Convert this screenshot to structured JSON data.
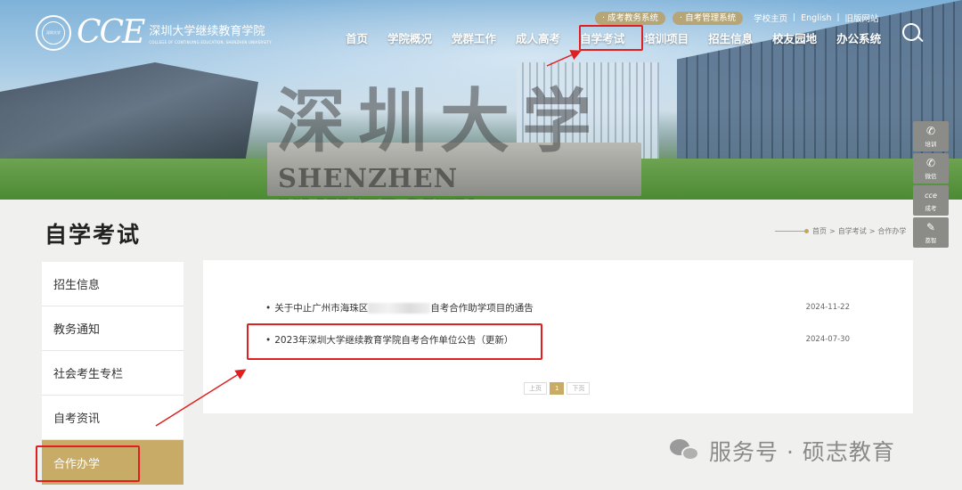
{
  "header": {
    "logo": {
      "seal_text": "深圳大学",
      "cce": "CCE",
      "name_cn": "深圳大学继续教育学院",
      "name_en": "COLLEGE OF CONTINUING EDUCATION, SHENZHEN UNIVERSITY"
    },
    "top_links": {
      "pill_1": "· 成考教务系统",
      "pill_2": "· 自考管理系统",
      "school_home": "学校主页",
      "english": "English",
      "old_site": "旧版网站",
      "separator": "|"
    },
    "nav": [
      "首页",
      "学院概况",
      "党群工作",
      "成人高考",
      "自学考试",
      "培训项目",
      "招生信息",
      "校友园地",
      "办公系统"
    ]
  },
  "banner": {
    "calligraphy": "深圳大学",
    "university_name": "SHENZHEN UNIVERSITY"
  },
  "side_tools": [
    {
      "icon": "wechat-icon",
      "glyph": "✆",
      "label": "培训"
    },
    {
      "icon": "wechat-icon",
      "glyph": "✆",
      "label": "微信"
    },
    {
      "icon": "cce-icon",
      "glyph": "cce",
      "label": "成考"
    },
    {
      "icon": "bird-icon",
      "glyph": "✎",
      "label": "荔智"
    }
  ],
  "page": {
    "title": "自学考试",
    "breadcrumb": [
      "首页",
      "自学考试",
      "合作办学"
    ],
    "breadcrumb_sep": ">"
  },
  "sidebar": {
    "items": [
      "招生信息",
      "教务通知",
      "社会考生专栏",
      "自考资讯",
      "合作办学"
    ],
    "active_index": 4
  },
  "news": [
    {
      "title_prefix": "关于中止广州市海珠区",
      "title_suffix": "自考合作助学项目的通告",
      "date": "2024-11-22"
    },
    {
      "title": "2023年深圳大学继续教育学院自考合作单位公告（更新）",
      "date": "2024-07-30"
    }
  ],
  "pager": {
    "prev": "上页",
    "current": "1",
    "next": "下页"
  },
  "watermark": {
    "text": "服务号 · 硕志教育"
  },
  "colors": {
    "accent_gold": "#c8ab66",
    "highlight_red": "#e02020"
  }
}
